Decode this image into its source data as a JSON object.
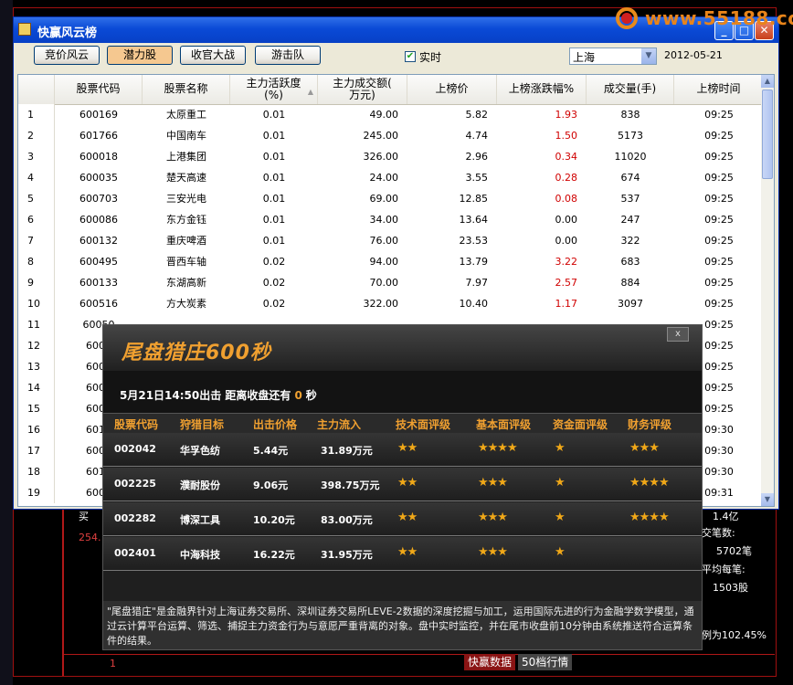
{
  "window": {
    "title": "快赢风云榜",
    "controls": [
      "_",
      "□",
      "✕"
    ]
  },
  "watermark": {
    "text": "www.55188.com"
  },
  "toolbar": {
    "tabs": [
      {
        "label": "竞价风云",
        "active": false
      },
      {
        "label": "潜力股",
        "active": true
      },
      {
        "label": "收官大战",
        "active": false
      },
      {
        "label": "游击队",
        "active": false
      }
    ],
    "realtime_label": "实时",
    "realtime_checked": true,
    "market": "上海",
    "date": "2012-05-21"
  },
  "table": {
    "columns": [
      "股票代码",
      "股票名称",
      "主力活跃度\n(%)",
      "主力成交额(\n万元)",
      "上榜价",
      "上榜涨跌幅%",
      "成交量(手)",
      "上榜时间"
    ],
    "rows": [
      {
        "n": "1",
        "code": "600169",
        "name": "太原重工",
        "act": "0.01",
        "amt": "49.00",
        "price": "5.82",
        "chg": "1.93",
        "vol": "838",
        "time": "09:25",
        "up": true
      },
      {
        "n": "2",
        "code": "601766",
        "name": "中国南车",
        "act": "0.01",
        "amt": "245.00",
        "price": "4.74",
        "chg": "1.50",
        "vol": "5173",
        "time": "09:25",
        "up": true
      },
      {
        "n": "3",
        "code": "600018",
        "name": "上港集团",
        "act": "0.01",
        "amt": "326.00",
        "price": "2.96",
        "chg": "0.34",
        "vol": "11020",
        "time": "09:25",
        "up": true
      },
      {
        "n": "4",
        "code": "600035",
        "name": "楚天高速",
        "act": "0.01",
        "amt": "24.00",
        "price": "3.55",
        "chg": "0.28",
        "vol": "674",
        "time": "09:25",
        "up": true
      },
      {
        "n": "5",
        "code": "600703",
        "name": "三安光电",
        "act": "0.01",
        "amt": "69.00",
        "price": "12.85",
        "chg": "0.08",
        "vol": "537",
        "time": "09:25",
        "up": true
      },
      {
        "n": "6",
        "code": "600086",
        "name": "东方金钰",
        "act": "0.01",
        "amt": "34.00",
        "price": "13.64",
        "chg": "0.00",
        "vol": "247",
        "time": "09:25",
        "up": false
      },
      {
        "n": "7",
        "code": "600132",
        "name": "重庆啤酒",
        "act": "0.01",
        "amt": "76.00",
        "price": "23.53",
        "chg": "0.00",
        "vol": "322",
        "time": "09:25",
        "up": false
      },
      {
        "n": "8",
        "code": "600495",
        "name": "晋西车轴",
        "act": "0.02",
        "amt": "94.00",
        "price": "13.79",
        "chg": "3.22",
        "vol": "683",
        "time": "09:25",
        "up": true
      },
      {
        "n": "9",
        "code": "600133",
        "name": "东湖高新",
        "act": "0.02",
        "amt": "70.00",
        "price": "7.97",
        "chg": "2.57",
        "vol": "884",
        "time": "09:25",
        "up": true
      },
      {
        "n": "10",
        "code": "600516",
        "name": "方大炭素",
        "act": "0.02",
        "amt": "322.00",
        "price": "10.40",
        "chg": "1.17",
        "vol": "3097",
        "time": "09:25",
        "up": true
      },
      {
        "n": "11",
        "code": "60050",
        "name": "",
        "act": "",
        "amt": "",
        "price": "",
        "chg": "",
        "vol": "",
        "time": "09:25",
        "up": false
      },
      {
        "n": "12",
        "code": "6004",
        "name": "",
        "act": "",
        "amt": "",
        "price": "",
        "chg": "",
        "vol": "",
        "time": "09:25",
        "up": false
      },
      {
        "n": "13",
        "code": "6001",
        "name": "",
        "act": "",
        "amt": "",
        "price": "",
        "chg": "",
        "vol": "",
        "time": "09:25",
        "up": false
      },
      {
        "n": "14",
        "code": "6004",
        "name": "",
        "act": "",
        "amt": "",
        "price": "",
        "chg": "",
        "vol": "",
        "time": "09:25",
        "up": false
      },
      {
        "n": "15",
        "code": "6002",
        "name": "",
        "act": "",
        "amt": "",
        "price": "",
        "chg": "",
        "vol": "",
        "time": "09:25",
        "up": false
      },
      {
        "n": "16",
        "code": "6012",
        "name": "",
        "act": "",
        "amt": "",
        "price": "",
        "chg": "",
        "vol": "",
        "time": "09:30",
        "up": false
      },
      {
        "n": "17",
        "code": "6004",
        "name": "",
        "act": "",
        "amt": "",
        "price": "",
        "chg": "",
        "vol": "",
        "time": "09:30",
        "up": false
      },
      {
        "n": "18",
        "code": "6011",
        "name": "",
        "act": "",
        "amt": "",
        "price": "",
        "chg": "",
        "vol": "",
        "time": "09:30",
        "up": false
      },
      {
        "n": "19",
        "code": "6004",
        "name": "",
        "act": "",
        "amt": "",
        "price": "",
        "chg": "",
        "vol": "",
        "time": "09:31",
        "up": false
      }
    ]
  },
  "popup": {
    "title": "尾盘猎庄600秒",
    "close": "x",
    "notice_prefix": "5月21日14:50出击 距离收盘还有",
    "countdown": "0",
    "notice_suffix": "秒",
    "headers": [
      "股票代码",
      "狩猎目标",
      "出击价格",
      "主力流入",
      "技术面评级",
      "基本面评级",
      "资金面评级",
      "财务评级"
    ],
    "rows": [
      {
        "code": "002042",
        "name": "华孚色纺",
        "price": "5.44元",
        "flow": "31.89万元",
        "tech": 2,
        "fund": 4,
        "cap": 1,
        "fin": 3
      },
      {
        "code": "002225",
        "name": "濮耐股份",
        "price": "9.06元",
        "flow": "398.75万元",
        "tech": 2,
        "fund": 3,
        "cap": 1,
        "fin": 4
      },
      {
        "code": "002282",
        "name": "博深工具",
        "price": "10.20元",
        "flow": "83.00万元",
        "tech": 2,
        "fund": 3,
        "cap": 1,
        "fin": 4
      },
      {
        "code": "002401",
        "name": "中海科技",
        "price": "16.22元",
        "flow": "31.95万元",
        "tech": 2,
        "fund": 3,
        "cap": 1,
        "fin": 0
      }
    ],
    "description": "\"尾盘猎庄\"是金融界针对上海证券交易所、深圳证券交易所LEVE-2数据的深度挖掘与加工，运用国际先进的行为金融学数学模型，通过云计算平台运算、筛选、捕捉主力资金行为与意愿严重背离的对象。盘中实时监控，并在尾市收盘前10分钟由系统推送符合运算条件的结果。"
  },
  "background": {
    "left_values": [
      "买",
      "254."
    ],
    "right_values": [
      "1.4亿",
      "交笔数:",
      "5702笔",
      "平均每笔:",
      "1503股",
      "例为102.45%"
    ],
    "bottom_index": "1",
    "bottom_tabs": [
      "快赢数据",
      "50档行情"
    ]
  }
}
